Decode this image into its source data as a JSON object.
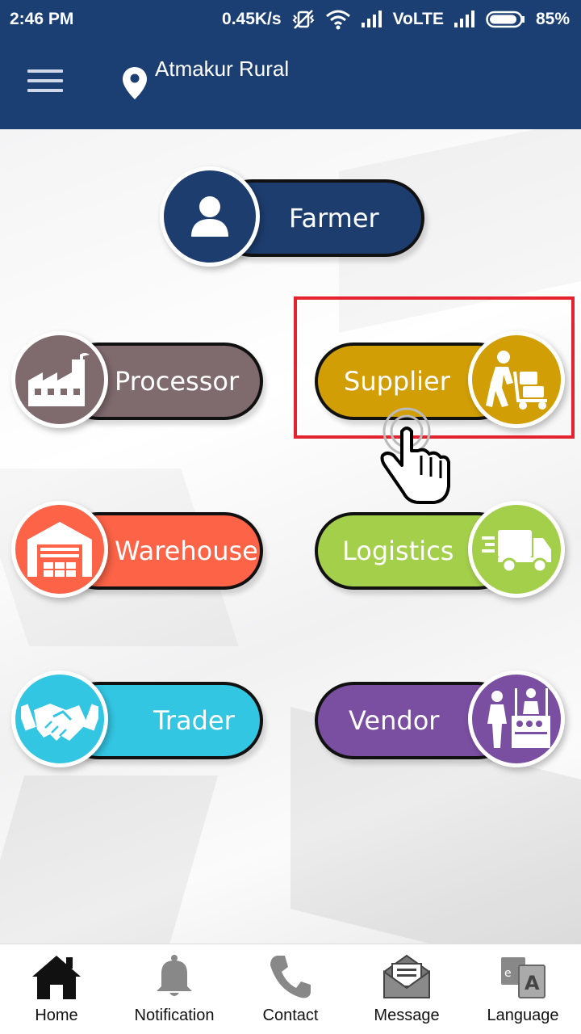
{
  "status_bar": {
    "time": "2:46 PM",
    "speed": "0.45K/s",
    "network": "VoLTE",
    "battery": "85%"
  },
  "header": {
    "location": "Atmakur Rural"
  },
  "roles": [
    {
      "label": "Farmer",
      "color": "#1c3d6e",
      "icon": "user-icon"
    },
    {
      "label": "Processor",
      "color": "#7f6a6e",
      "icon": "factory-icon"
    },
    {
      "label": "Supplier",
      "color": "#d19e05",
      "icon": "porter-cart-icon"
    },
    {
      "label": "Warehouse",
      "color": "#fc6347",
      "icon": "warehouse-icon"
    },
    {
      "label": "Logistics",
      "color": "#a3cf4b",
      "icon": "delivery-truck-icon"
    },
    {
      "label": "Trader",
      "color": "#33c6e3",
      "icon": "handshake-icon"
    },
    {
      "label": "Vendor",
      "color": "#7a4ea0",
      "icon": "market-stall-icon"
    }
  ],
  "bottom_nav": {
    "home": "Home",
    "notification": "Notification",
    "contact": "Contact",
    "message": "Message",
    "language": "Language"
  },
  "highlight_color": "#e32430"
}
